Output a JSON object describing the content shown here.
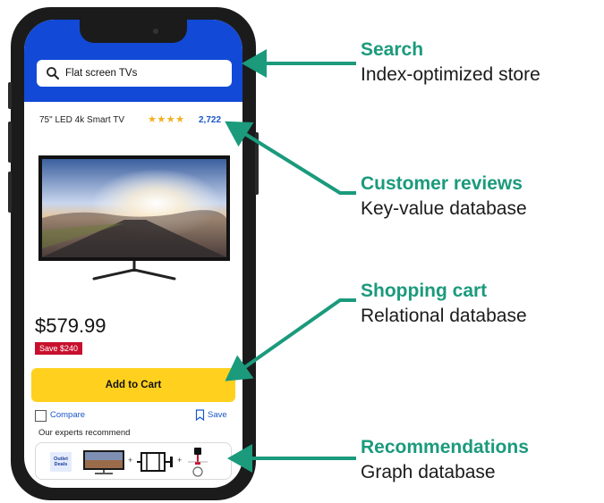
{
  "app": {
    "search": {
      "query": "Flat screen TVs"
    },
    "product": {
      "title": "75\" LED 4k Smart TV",
      "stars": "★★★★",
      "review_count": "2,722",
      "price": "$579.99",
      "save_badge": "Save $240",
      "add_to_cart": "Add to Cart",
      "compare": "Compare",
      "save": "Save"
    },
    "recommendations": {
      "heading": "Our experts recommend",
      "outlet_badge": "Outlet Deals",
      "plus": "+"
    }
  },
  "annotations": [
    {
      "title": "Search",
      "subtitle": "Index-optimized store"
    },
    {
      "title": "Customer reviews",
      "subtitle": "Key-value database"
    },
    {
      "title": "Shopping cart",
      "subtitle": "Relational database"
    },
    {
      "title": "Recommendations",
      "subtitle": "Graph database"
    }
  ],
  "colors": {
    "accent_green": "#1b9a7c",
    "header_blue": "#1249d6",
    "cart_yellow": "#ffd11e",
    "badge_red": "#c8102e",
    "link_blue": "#1a56c9",
    "star_gold": "#f2b01e"
  }
}
